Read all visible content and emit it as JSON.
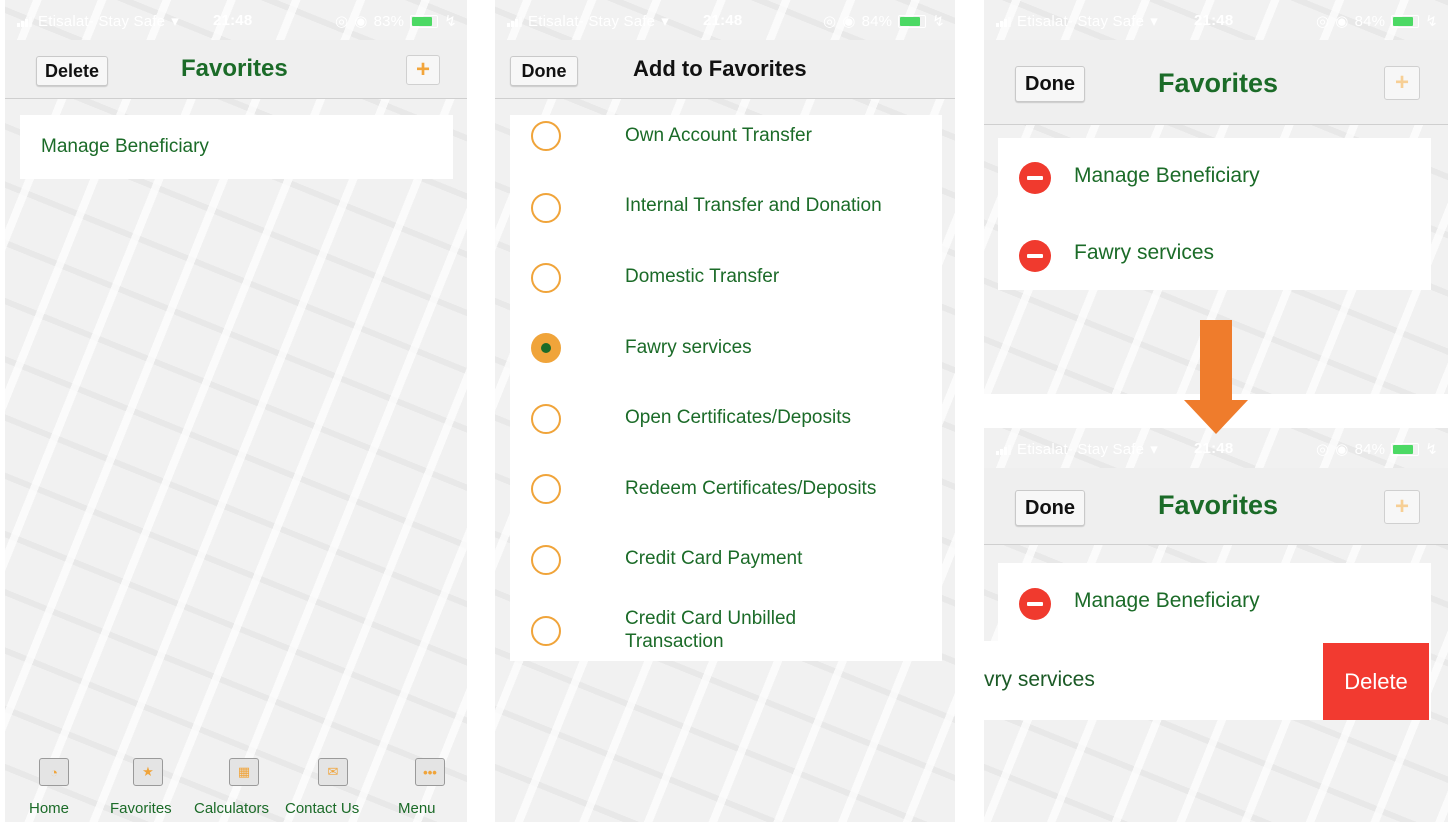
{
  "status": {
    "carrier": "Etisalat- Stay Safe",
    "time": "21:48",
    "battery_left": "83%",
    "battery_other": "84%"
  },
  "screen1": {
    "delete_button": "Delete",
    "title": "Favorites",
    "plus": "+",
    "items": [
      "Manage Beneficiary"
    ]
  },
  "screen2": {
    "done_button": "Done",
    "title": "Add to Favorites",
    "items": [
      {
        "label": "Own Account Transfer",
        "checked": false
      },
      {
        "label": "Internal Transfer and Donation",
        "checked": false
      },
      {
        "label": "Domestic Transfer",
        "checked": false
      },
      {
        "label": "Fawry services",
        "checked": true
      },
      {
        "label": "Open Certificates/Deposits",
        "checked": false
      },
      {
        "label": "Redeem Certificates/Deposits",
        "checked": false
      },
      {
        "label": "Credit Card Payment",
        "checked": false
      },
      {
        "label": "Credit Card Unbilled Transaction",
        "checked": false
      }
    ]
  },
  "screen3": {
    "done_button": "Done",
    "title": "Favorites",
    "plus": "+",
    "items": [
      "Manage Beneficiary",
      "Fawry services"
    ]
  },
  "screen4": {
    "done_button": "Done",
    "title": "Favorites",
    "plus": "+",
    "items": [
      "Manage Beneficiary"
    ],
    "swiped_item": "vry services",
    "delete_action": "Delete"
  },
  "tabbar": {
    "tabs": [
      {
        "label": "Home",
        "icon": "speedometer-icon"
      },
      {
        "label": "Favorites",
        "icon": "star-icon"
      },
      {
        "label": "Calculators",
        "icon": "calculator-icon"
      },
      {
        "label": "Contact Us",
        "icon": "envelope-icon"
      },
      {
        "label": "Menu",
        "icon": "more-dots-icon"
      }
    ]
  },
  "colors": {
    "brand_green": "#1b6b28",
    "accent_orange": "#f0a43a",
    "delete_red": "#f23a30",
    "arrow_orange": "#ef7c2c"
  }
}
